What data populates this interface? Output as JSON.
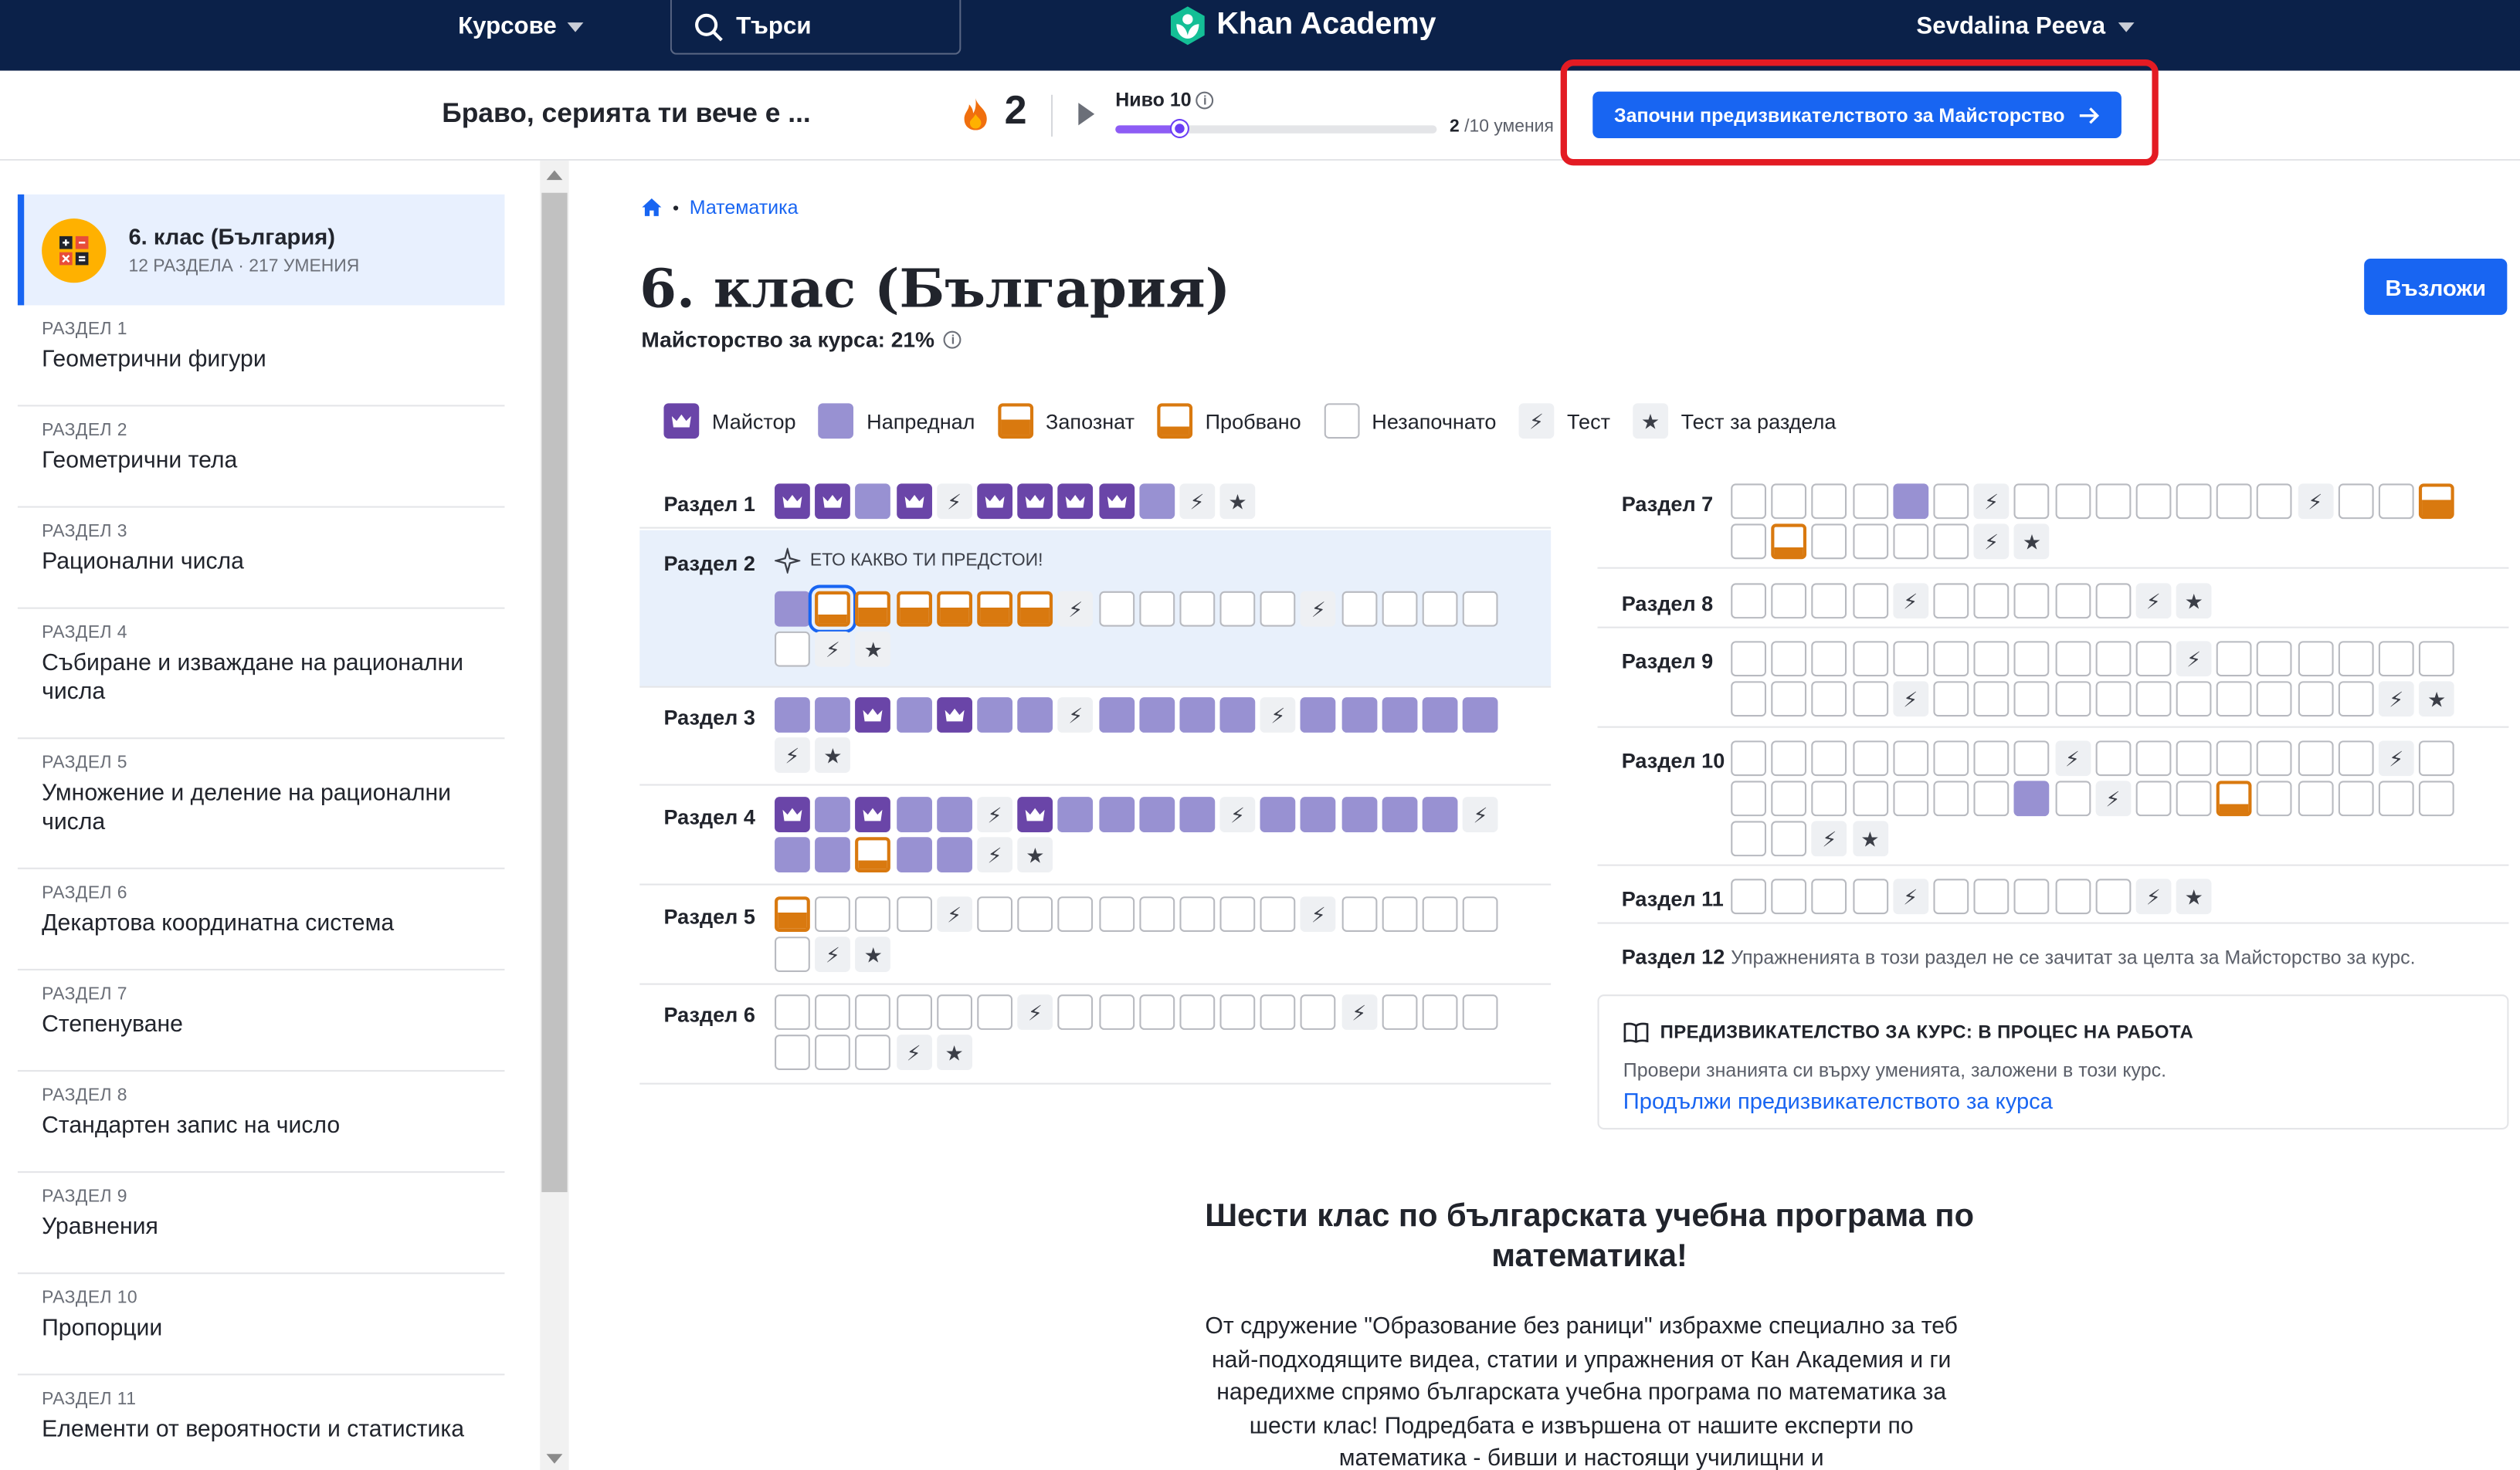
{
  "nav": {
    "courses": "Курсове",
    "search": "Търси",
    "logo": "Khan Academy",
    "user": "Sevdalina Peeva"
  },
  "streak": {
    "message": "Браво, серията ти вече е ...",
    "count": "2",
    "level_label": "Ниво 10",
    "level_progress": 0.2,
    "count_done": "2",
    "count_rest": "/10 умения"
  },
  "challenge_button": "Започни предизвикателството за Майсторство",
  "sidebar": {
    "course_title": "6. клас (България)",
    "course_sub": "12 РАЗДЕЛА · 217 УМЕНИЯ",
    "units": [
      {
        "label": "РАЗДЕЛ 1",
        "name": "Геометрични фигури"
      },
      {
        "label": "РАЗДЕЛ 2",
        "name": "Геометрични тела"
      },
      {
        "label": "РАЗДЕЛ 3",
        "name": "Рационални числа"
      },
      {
        "label": "РАЗДЕЛ 4",
        "name": "Събиране и изваждане на рационални числа"
      },
      {
        "label": "РАЗДЕЛ 5",
        "name": "Умножение и деление на рационални числа"
      },
      {
        "label": "РАЗДЕЛ 6",
        "name": "Декартова координатна система"
      },
      {
        "label": "РАЗДЕЛ 7",
        "name": "Степенуване"
      },
      {
        "label": "РАЗДЕЛ 8",
        "name": "Стандартен запис на число"
      },
      {
        "label": "РАЗДЕЛ 9",
        "name": "Уравнения"
      },
      {
        "label": "РАЗДЕЛ 10",
        "name": "Пропорции"
      },
      {
        "label": "РАЗДЕЛ 11",
        "name": "Елементи от вероятности и статистика"
      }
    ]
  },
  "main": {
    "breadcrumb": "Математика",
    "title": "6. клас (България)",
    "mastery": "Майсторство за курса: 21%",
    "share": "Възложи",
    "legend": {
      "mastered": "Майстор",
      "proficient": "Напреднал",
      "familiar": "Запознат",
      "attempted": "Пробвано",
      "not_started": "Незапочнато",
      "quiz": "Тест",
      "unit_test": "Тест за раздела"
    },
    "up_next": "ЕТО КАКВО ТИ ПРЕДСТОИ!",
    "sections": [
      {
        "label": "Раздел 1",
        "cells": "MMPMQMMMMPQT"
      },
      {
        "label": "Раздел 2",
        "cells": "PaFFFFFQEEEEEQEEEEEQT"
      },
      {
        "label": "Раздел 3",
        "cells": "PPMPMPPQPPPPQPPPPPQT"
      },
      {
        "label": "Раздел 4",
        "cells": "MPMPPQMPPPPQPPPPPQPPaPPQT"
      },
      {
        "label": "Раздел 5",
        "cells": "FEEEQEEEEEEEEQEEEEEQT"
      },
      {
        "label": "Раздел 6",
        "cells": "EEEEEEQEEEEEEEQEEEEEEQT"
      },
      {
        "label": "Раздел 7",
        "cells": "EEEEPEQEEEEEEEQEEFEaEEEEQT"
      },
      {
        "label": "Раздел 8",
        "cells": "EEEEQEEEEEQT"
      },
      {
        "label": "Раздел 9",
        "cells": "EEEEEEEEEEEQEEEEEEEEEEQEEEEEEEEEEEQT"
      },
      {
        "label": "Раздел 10",
        "cells": "EEEEEEEEQEEEEEEEQEEEEEEEEPEQEEaEEEEEEEQT"
      },
      {
        "label": "Раздел 11",
        "cells": "EEEEQEEEEEQT"
      },
      {
        "label": "Раздел 12",
        "note": "Упражненията в този раздел не се зачитат за целта за Майсторство за курс."
      }
    ],
    "course_challenge": {
      "heading": "ПРЕДИЗВИКАТЕЛСТВО ЗА КУРС: В ПРОЦЕС НА РАБОТА",
      "text": "Провери знанията си върху уменията, заложени в този курс.",
      "link": "Продължи предизвикателството за курса"
    },
    "intro_heading": "Шести клас по българската учебна програма по математика!",
    "intro_text": "От сдружение \"Образование без раници\" избрахме специално за теб най-подходящите видеа, статии и упражнения от Кан Академия и ги наредихме спрямо българската учебна програма по математика за шести клас! Подредбата е извършена от нашите експерти по математика - бивши и настоящи училищни и"
  }
}
